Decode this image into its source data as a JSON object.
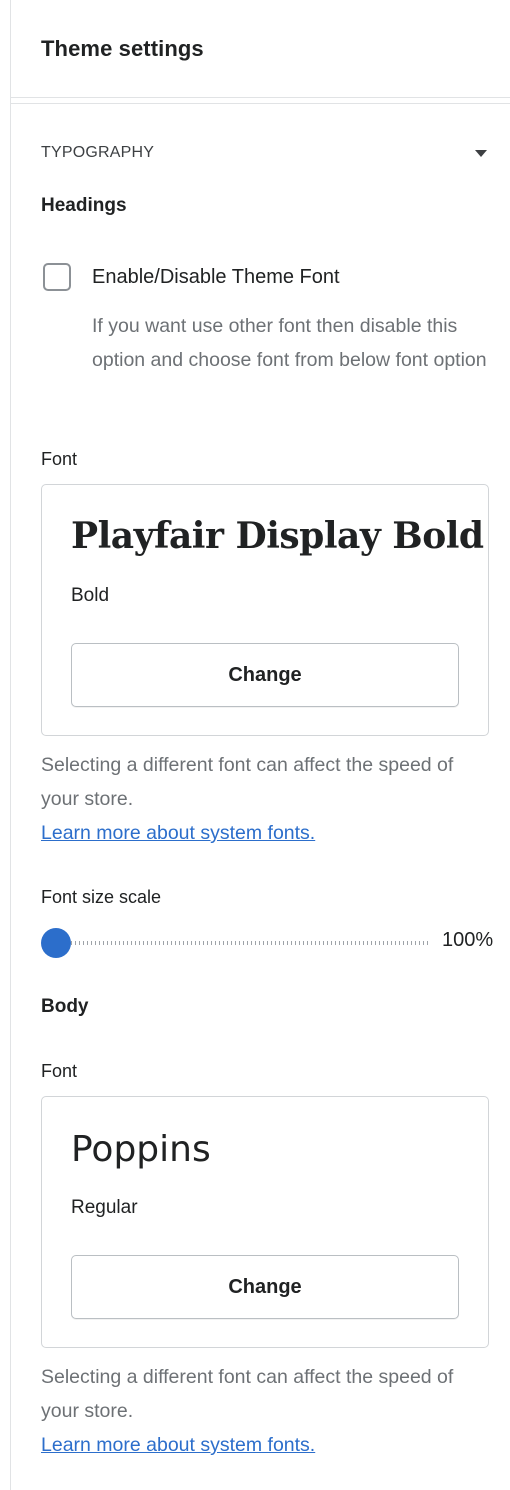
{
  "header": {
    "title": "Theme settings"
  },
  "section": {
    "label": "TYPOGRAPHY",
    "toggle_icon": "caret-down-icon"
  },
  "headings": {
    "title": "Headings",
    "theme_font_checkbox": {
      "label": "Enable/Disable Theme Font",
      "checked": false,
      "help": "If you want use other font then disable this option and choose font from below font option"
    },
    "font_label": "Font",
    "font": {
      "name": "Playfair Display Bold",
      "style": "Bold",
      "change_label": "Change"
    },
    "help": "Selecting a different font can affect the speed of your store.",
    "link": "Learn more about system fonts.",
    "size_scale": {
      "label": "Font size scale",
      "value": "100%",
      "fraction": 0.0
    }
  },
  "body": {
    "title": "Body",
    "font_label": "Font",
    "font": {
      "name": "Poppins",
      "style": "Regular",
      "change_label": "Change"
    },
    "help": "Selecting a different font can affect the speed of your store.",
    "link": "Learn more about system fonts."
  },
  "colors": {
    "accent": "#2c6ecb",
    "text": "#202223",
    "subdued": "#6d7175",
    "border": "#d2d5d8"
  }
}
